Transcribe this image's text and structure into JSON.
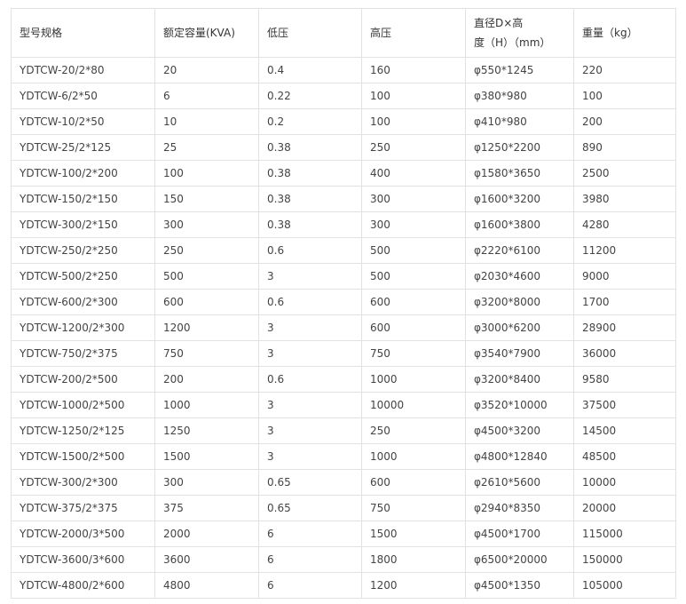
{
  "table": {
    "headers": [
      [
        "型号规格"
      ],
      [
        "额定容量(KVA)"
      ],
      [
        "低压"
      ],
      [
        "高压"
      ],
      [
        "直径D×高",
        "度（H）（mm）"
      ],
      [
        "重量（kg）"
      ]
    ],
    "rows": [
      [
        "YDTCW-20/2*80",
        "20",
        "0.4",
        "160",
        "φ550*1245",
        "220"
      ],
      [
        "YDTCW-6/2*50",
        "6",
        "0.22",
        "100",
        "φ380*980",
        "100"
      ],
      [
        "YDTCW-10/2*50",
        "10",
        "0.2",
        "100",
        "φ410*980",
        "200"
      ],
      [
        "YDTCW-25/2*125",
        "25",
        "0.38",
        "250",
        "φ1250*2200",
        "890"
      ],
      [
        "YDTCW-100/2*200",
        "100",
        "0.38",
        "400",
        "φ1580*3650",
        "2500"
      ],
      [
        "YDTCW-150/2*150",
        "150",
        "0.38",
        "300",
        "φ1600*3200",
        "3980"
      ],
      [
        "YDTCW-300/2*150",
        "300",
        "0.38",
        "300",
        "φ1600*3800",
        "4280"
      ],
      [
        "YDTCW-250/2*250",
        "250",
        "0.6",
        "500",
        "φ2220*6100",
        "11200"
      ],
      [
        "YDTCW-500/2*250",
        "500",
        "3",
        "500",
        "φ2030*4600",
        "9000"
      ],
      [
        "YDTCW-600/2*300",
        "600",
        "0.6",
        "600",
        "φ3200*8000",
        "1700"
      ],
      [
        "YDTCW-1200/2*300",
        "1200",
        "3",
        "600",
        "φ3000*6200",
        "28900"
      ],
      [
        "YDTCW-750/2*375",
        "750",
        "3",
        "750",
        "φ3540*7900",
        "36000"
      ],
      [
        "YDTCW-200/2*500",
        "200",
        "0.6",
        "1000",
        "φ3200*8400",
        "9580"
      ],
      [
        "YDTCW-1000/2*500",
        "1000",
        "3",
        "10000",
        "φ3520*10000",
        "37500"
      ],
      [
        "YDTCW-1250/2*125",
        "1250",
        "3",
        "250",
        "φ4500*3200",
        "14500"
      ],
      [
        "YDTCW-1500/2*500",
        "1500",
        "3",
        "1000",
        "φ4800*12840",
        "48500"
      ],
      [
        "YDTCW-300/2*300",
        "300",
        "0.65",
        "600",
        "φ2610*5600",
        "10000"
      ],
      [
        "YDTCW-375/2*375",
        "375",
        "0.65",
        "750",
        "φ2940*8350",
        "20000"
      ],
      [
        "YDTCW-2000/3*500",
        "2000",
        "6",
        "1500",
        "φ4500*1700",
        "115000"
      ],
      [
        "YDTCW-3600/3*600",
        "3600",
        "6",
        "1800",
        "φ6500*20000",
        "150000"
      ],
      [
        "YDTCW-4800/2*600",
        "4800",
        "6",
        "1200",
        "φ4500*1350",
        "105000"
      ]
    ]
  }
}
